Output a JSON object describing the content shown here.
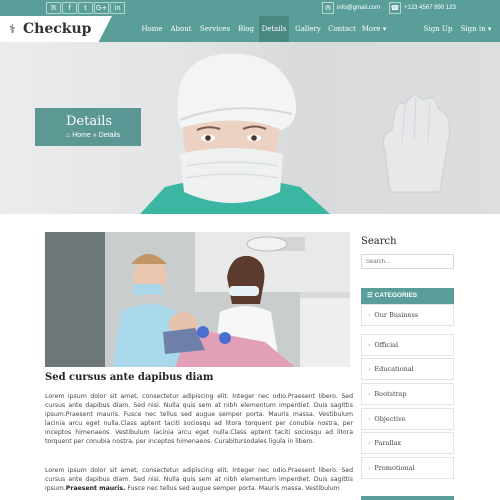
{
  "topbar": {
    "social_icons": [
      "rss-icon",
      "facebook-icon",
      "twitter-icon",
      "google-plus-icon",
      "linkedin-icon"
    ],
    "social_glyphs": [
      "ℜ",
      "f",
      "t",
      "G+",
      "in"
    ],
    "email": "info@gmail.com",
    "phone": "+123 4567 890 123"
  },
  "brand": {
    "name": "Checkup"
  },
  "nav": {
    "items": [
      "Home",
      "About",
      "Services",
      "Blog",
      "Details",
      "Gallery",
      "Contact",
      "More ▾"
    ],
    "active": "Details",
    "signup": "Sign Up",
    "signin": "Sign in ▾"
  },
  "hero": {
    "title": "Details",
    "crumb_home": "Home",
    "crumb_sep": "»",
    "crumb_current": "Details"
  },
  "article": {
    "title": "Sed cursus ante dapibus diam",
    "para1": "Lorem ipsum dolor sit amet, consectetur adipiscing elit. Integer nec odio.Praesent libero. Sed cursus ante dapibus diam. Sed nisi. Nulla quis sem at nibh elementum imperdiet. Duis sagittis ipsum.Praesent mauris. Fusce nec tellus sed augue semper porta. Mauris massa. Vestibulum lacinia arcu eget nulla.Class aptent taciti sociosqu ad litora torquent per conubia nostra, per inceptos himenaeos. Vestibulum lacinia arcu eget nulla.Class aptent taciti sociosqu ad litora torquent per conubia nostra, per inceptos himenaeos. Curabitursodales ligula in libero.",
    "para2_a": "Lorem ipsum dolor sit amet, consectetur adipiscing elit. Integer nec odio.Praesent libero. Sed cursus ante dapibus diam. Sed nisi. Nulla quis sem at nibh elementum imperdiet. Duis sagittis ipsum.",
    "para2_bold": "Praesent mauris.",
    "para2_b": " Fusce nec tellus sed augue semper porta. Mauris massa. Vestibulum"
  },
  "sidebar": {
    "search_title": "Search",
    "search_placeholder": "Search...",
    "categories_title": "CATEGORIES",
    "categories": [
      "Our Business",
      "Official",
      "Educational",
      "Bootstrap",
      "Objective",
      "Parallax",
      "Promotional"
    ]
  },
  "colors": {
    "accent": "#5a9e9a",
    "accent_dark": "#4a8884"
  }
}
